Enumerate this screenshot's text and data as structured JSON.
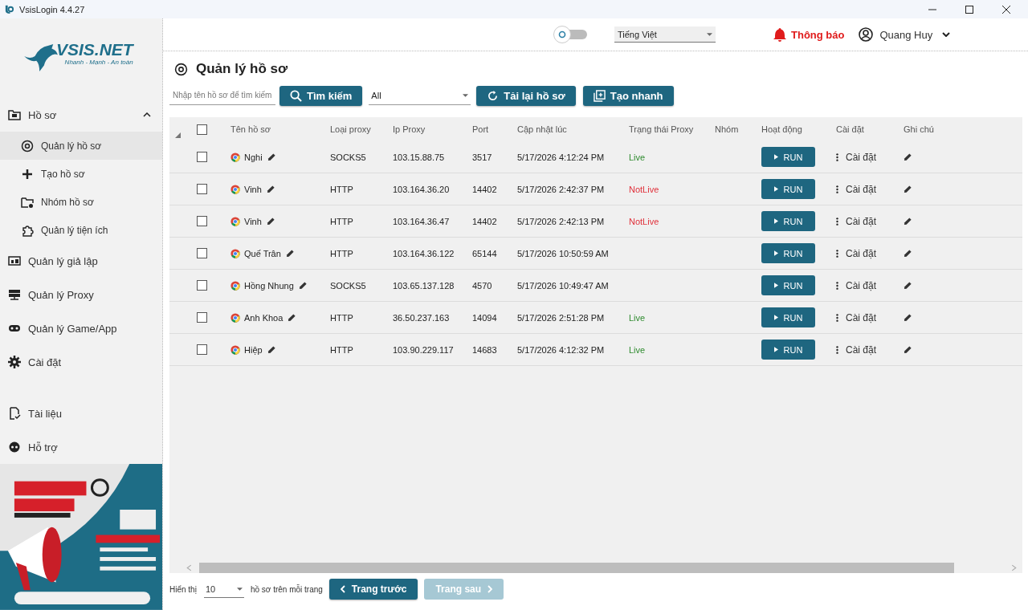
{
  "window": {
    "title": "VsisLogin 4.4.27"
  },
  "logo": {
    "name": "VSIS.NET",
    "tagline": "Nhanh - Mạnh - An toàn"
  },
  "sidebar": {
    "items": [
      {
        "label": "Hồ sơ",
        "expanded": true,
        "selected": false,
        "children": [
          {
            "label": "Quản lý hồ sơ",
            "selected": true
          },
          {
            "label": "Tạo hồ sơ",
            "selected": false
          },
          {
            "label": "Nhóm hồ sơ",
            "selected": false
          },
          {
            "label": "Quản lý tiện ích",
            "selected": false
          }
        ]
      },
      {
        "label": "Quản lý giả lập",
        "selected": false
      },
      {
        "label": "Quản lý Proxy",
        "selected": false
      },
      {
        "label": "Quản lý Game/App",
        "selected": false
      },
      {
        "label": "Cài đặt",
        "selected": false
      }
    ],
    "bottom_items": [
      {
        "label": "Tài liệu",
        "selected": false
      },
      {
        "label": "Hỗ trợ",
        "selected": false
      }
    ]
  },
  "header": {
    "theme_toggle": {
      "on": false
    },
    "language": "Tiếng Việt",
    "notifications": "Thông báo",
    "user": "Quang Huy"
  },
  "page": {
    "title": "Quản lý hồ sơ"
  },
  "toolbar": {
    "search": {
      "placeholder": "Nhập tên hồ sơ để tìm kiếm"
    },
    "search_button": "Tìm kiếm",
    "filter": "All",
    "reload_button": "Tải lại hồ sơ",
    "quick_create_button": "Tạo nhanh"
  },
  "table": {
    "header_checked": false,
    "columns": [
      "Tên hồ sơ",
      "Loại proxy",
      "Ip Proxy",
      "Port",
      "Cập nhật lúc",
      "Trạng thái Proxy",
      "Nhóm",
      "Hoạt động",
      "Cài đặt",
      "Ghi chú"
    ],
    "rows": [
      {
        "checked": false,
        "name": "Nghi",
        "proxy_type": "SOCKS5",
        "ip": "103.15.88.75",
        "port": "3517",
        "updated": "5/17/2026 4:12:24 PM",
        "status": "Live",
        "color": "#2e8b2e",
        "action": "RUN",
        "settings": "Cài đặt"
      },
      {
        "checked": false,
        "name": "Vinh",
        "proxy_type": "HTTP",
        "ip": "103.164.36.20",
        "port": "14402",
        "updated": "5/17/2026 2:42:37 PM",
        "status": "NotLive",
        "color": "#e0303a",
        "action": "RUN",
        "settings": "Cài đặt"
      },
      {
        "checked": false,
        "name": "Vinh",
        "proxy_type": "HTTP",
        "ip": "103.164.36.47",
        "port": "14402",
        "updated": "5/17/2026 2:42:13 PM",
        "status": "NotLive",
        "color": "#e0303a",
        "action": "RUN",
        "settings": "Cài đặt"
      },
      {
        "checked": false,
        "name": "Quế Trân",
        "proxy_type": "HTTP",
        "ip": "103.164.36.122",
        "port": "65144",
        "updated": "5/17/2026 10:50:59 AM",
        "action": "RUN",
        "settings": "Cài đặt"
      },
      {
        "checked": false,
        "name": "Hồng Nhung",
        "proxy_type": "SOCKS5",
        "ip": "103.65.137.128",
        "port": "4570",
        "updated": "5/17/2026 10:49:47 AM",
        "action": "RUN",
        "settings": "Cài đặt"
      },
      {
        "checked": false,
        "name": "Anh Khoa",
        "proxy_type": "HTTP",
        "ip": "36.50.237.163",
        "port": "14094",
        "updated": "5/17/2026 2:51:28 PM",
        "status": "Live",
        "color": "#2e8b2e",
        "action": "RUN",
        "settings": "Cài đặt"
      },
      {
        "checked": false,
        "name": "Hiệp",
        "proxy_type": "HTTP",
        "ip": "103.90.229.117",
        "port": "14683",
        "updated": "5/17/2026 4:12:32 PM",
        "status": "Live",
        "color": "#2e8b2e",
        "action": "RUN",
        "settings": "Cài đặt"
      }
    ]
  },
  "pagination": {
    "show_label": "Hiển thị",
    "page_size": "10",
    "per_page_label": "hồ sơ trên mỗi trang",
    "prev": {
      "label": "Trang trước",
      "disabled": false
    },
    "next": {
      "label": "Trang sau",
      "disabled": true
    }
  }
}
